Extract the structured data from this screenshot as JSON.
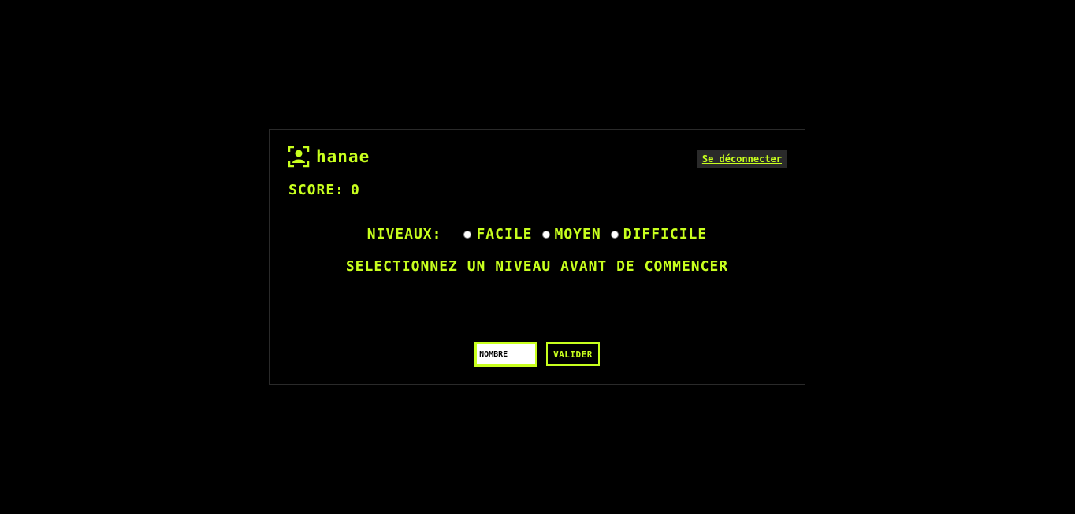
{
  "colors": {
    "accent": "#c8ff1e",
    "background": "#000000",
    "card_border": "#2a2a2a",
    "logout_bg": "#2a2a2a"
  },
  "user": {
    "icon": "user-scan-icon",
    "name": "hanae"
  },
  "logout_label": "Se déconnecter",
  "score": {
    "label": "SCORE:",
    "value": "0"
  },
  "levels": {
    "label": "NIVEAUX:",
    "options": [
      {
        "label": "FACILE",
        "selected": false
      },
      {
        "label": "MOYEN",
        "selected": false
      },
      {
        "label": "DIFFICILE",
        "selected": false
      }
    ]
  },
  "instruction": "SELECTIONNEZ UN NIVEAU AVANT DE COMMENCER",
  "input": {
    "placeholder": "NOMBRE",
    "value": ""
  },
  "submit_label": "VALIDER"
}
